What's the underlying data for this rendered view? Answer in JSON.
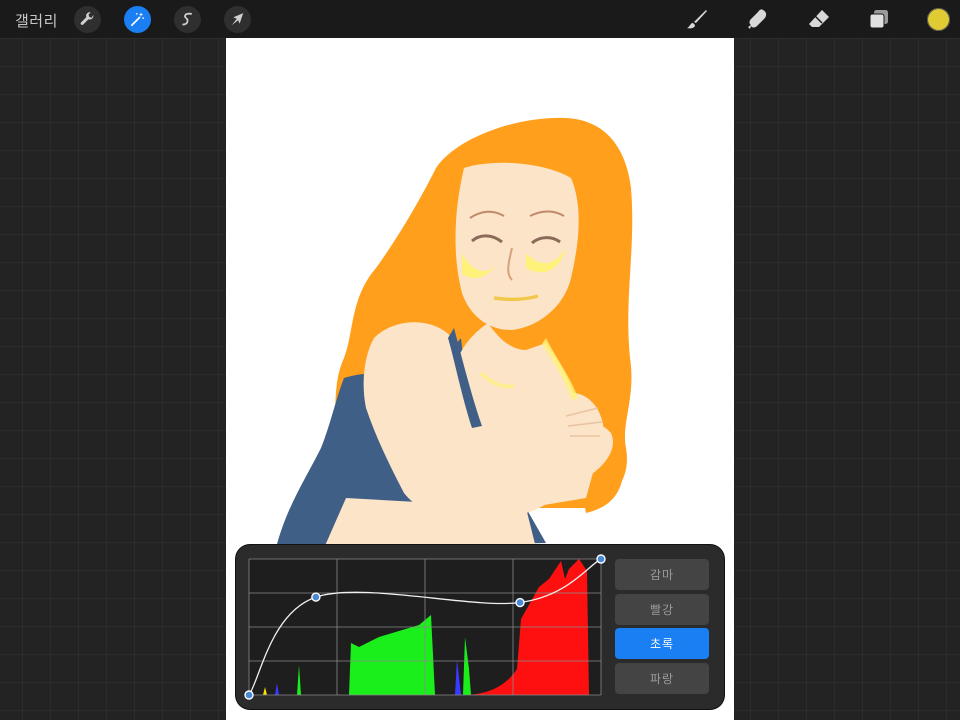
{
  "toolbar": {
    "gallery_label": "갤러리",
    "left_tools": [
      {
        "icon": "wrench-icon",
        "active": false
      },
      {
        "icon": "magic-wand-icon",
        "active": true
      },
      {
        "icon": "selection-s-icon",
        "active": false
      },
      {
        "icon": "arrow-transform-icon",
        "active": false
      }
    ],
    "right_tools": [
      "brush-icon",
      "smudge-icon",
      "eraser-icon",
      "layers-icon"
    ],
    "current_color": "#e1cb32"
  },
  "curves": {
    "channels": [
      {
        "label": "감마",
        "active": false
      },
      {
        "label": "빨강",
        "active": false
      },
      {
        "label": "초록",
        "active": true
      },
      {
        "label": "파랑",
        "active": false
      }
    ],
    "active_channel": "초록",
    "curve_points": [
      [
        0.0,
        0.0
      ],
      [
        0.19,
        0.72
      ],
      [
        0.77,
        0.68
      ],
      [
        1.0,
        1.0
      ]
    ],
    "accent_color": "#1a7ff2"
  },
  "artwork": {
    "hair_color": "#ff9f1c",
    "skin_color": "#fce4c8",
    "dress_color": "#3f5f86",
    "highlight_color": "#fff27a"
  }
}
